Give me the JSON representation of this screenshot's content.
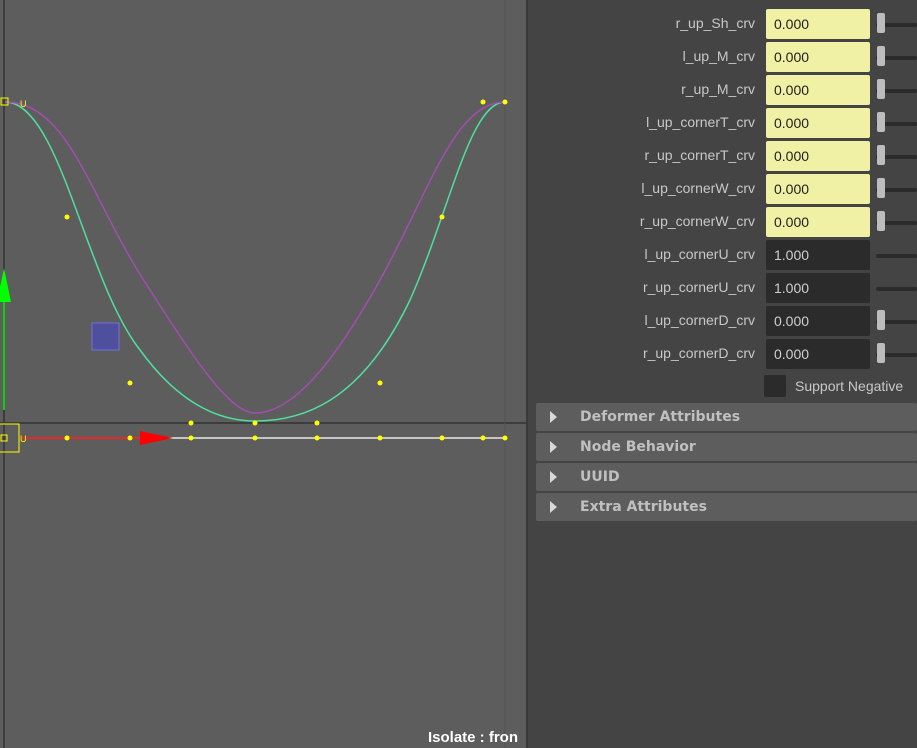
{
  "viewport": {
    "label": "Isolate : fron",
    "curve_point_label": "U",
    "origin_label": "U",
    "colors": {
      "background": "#5d5d5d",
      "curve_green": "#4fdf9f",
      "curve_purple": "#a24db0",
      "points": "#ffff00",
      "axis_x": "#ff0000",
      "axis_y": "#00ff00",
      "selection_box": "#4a4cb3"
    }
  },
  "attributes": [
    {
      "name": "r_up_Sh_crv",
      "value": "0.000",
      "keyed": true
    },
    {
      "name": "l_up_M_crv",
      "value": "0.000",
      "keyed": true
    },
    {
      "name": "r_up_M_crv",
      "value": "0.000",
      "keyed": true
    },
    {
      "name": "l_up_cornerT_crv",
      "value": "0.000",
      "keyed": true
    },
    {
      "name": "r_up_cornerT_crv",
      "value": "0.000",
      "keyed": true
    },
    {
      "name": "l_up_cornerW_crv",
      "value": "0.000",
      "keyed": true
    },
    {
      "name": "r_up_cornerW_crv",
      "value": "0.000",
      "keyed": true
    },
    {
      "name": "l_up_cornerU_crv",
      "value": "1.000",
      "keyed": false
    },
    {
      "name": "r_up_cornerU_crv",
      "value": "1.000",
      "keyed": false
    },
    {
      "name": "l_up_cornerD_crv",
      "value": "0.000",
      "keyed": false
    },
    {
      "name": "r_up_cornerD_crv",
      "value": "0.000",
      "keyed": false
    }
  ],
  "support_negative": {
    "label": "Support Negative",
    "checked": false
  },
  "sections": [
    {
      "label": "Deformer Attributes"
    },
    {
      "label": "Node Behavior"
    },
    {
      "label": "UUID"
    },
    {
      "label": "Extra Attributes"
    }
  ],
  "colors": {
    "keyed_field": "#f1f1a5",
    "plain_field": "#2b2b2b",
    "panel_bg": "#444444"
  }
}
